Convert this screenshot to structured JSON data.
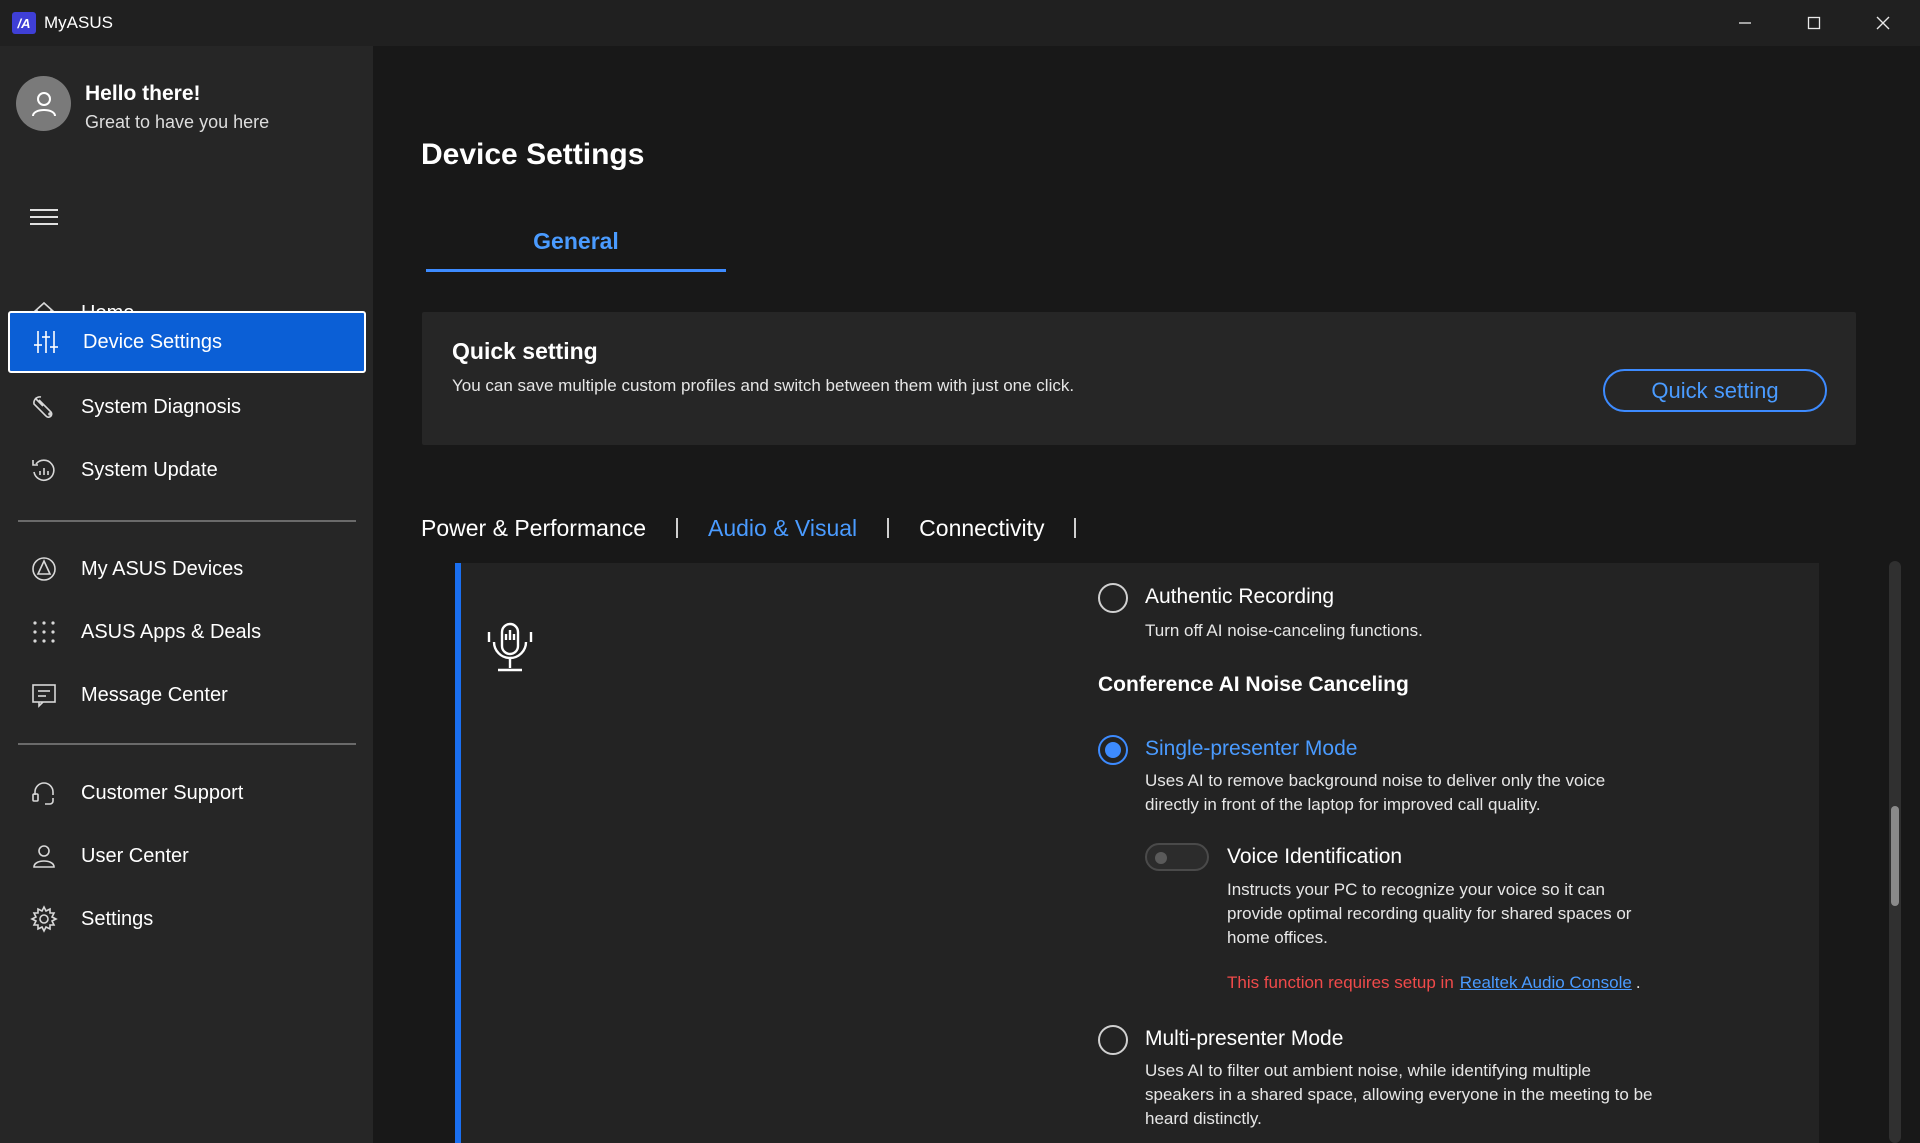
{
  "window": {
    "logo_text": "/A",
    "title": "MyASUS"
  },
  "user": {
    "greeting": "Hello there!",
    "subtitle": "Great to have you here"
  },
  "sidebar": {
    "items": [
      {
        "label": "Home",
        "icon": "home-icon"
      },
      {
        "label": "Device Settings",
        "icon": "sliders-icon",
        "active": true
      },
      {
        "label": "System Diagnosis",
        "icon": "wrench-icon"
      },
      {
        "label": "System Update",
        "icon": "update-icon"
      },
      {
        "label": "My ASUS Devices",
        "icon": "devices-icon"
      },
      {
        "label": "ASUS Apps & Deals",
        "icon": "apps-grid-icon"
      },
      {
        "label": "Message Center",
        "icon": "message-icon"
      },
      {
        "label": "Customer Support",
        "icon": "headset-icon"
      },
      {
        "label": "User Center",
        "icon": "user-icon"
      },
      {
        "label": "Settings",
        "icon": "gear-icon"
      }
    ]
  },
  "main": {
    "title": "Device Settings",
    "tab": "General",
    "quick_setting": {
      "title": "Quick setting",
      "description": "You can save multiple custom profiles and switch between them with just one click.",
      "button_label": "Quick setting"
    },
    "subtabs": [
      "Power & Performance",
      "Audio & Visual",
      "Connectivity"
    ],
    "audio": {
      "authentic_recording": {
        "label": "Authentic Recording",
        "description": "Turn off AI noise-canceling functions."
      },
      "section_title": "Conference AI Noise Canceling",
      "single_presenter": {
        "label": "Single-presenter Mode",
        "description_line1": "Uses AI to remove background noise to deliver only the voice",
        "description_line2": "directly in front of the laptop for improved call quality."
      },
      "voice_identification": {
        "label": "Voice Identification",
        "description_line1": "Instructs your PC to recognize your voice so it can",
        "description_line2": "provide optimal recording quality for shared spaces or",
        "description_line3": "home offices.",
        "warning_text": "This function requires setup in",
        "warning_link": "Realtek Audio Console",
        "warning_end": "."
      },
      "multi_presenter": {
        "label": "Multi-presenter Mode",
        "description_line1": "Uses AI to filter out ambient noise, while identifying multiple",
        "description_line2": "speakers in a shared space, allowing everyone in the meeting to be",
        "description_line3": "heard distinctly."
      }
    }
  },
  "colors": {
    "accent": "#3d8bff",
    "active_nav": "#0b5fd6",
    "warning": "#f04a4a"
  }
}
